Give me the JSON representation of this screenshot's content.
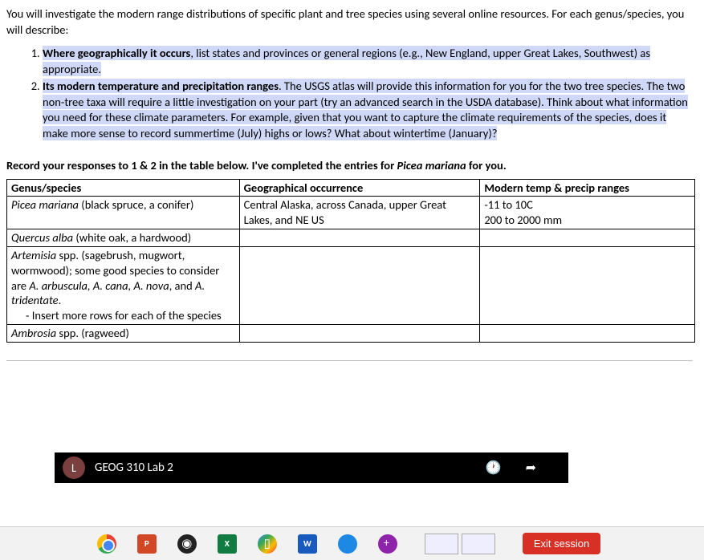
{
  "intro": "You will investigate the modern range distributions of specific plant and tree species using several online resources. For each genus/species, you will describe:",
  "list": {
    "item1_bold": "Where geographically it occurs",
    "item1_rest": ", list states and provinces or general regions (e.g., New England, upper Great Lakes, Southwest) as appropriate.",
    "item2_bold": "Its modern temperature and precipitation ranges",
    "item2_rest": ". The USGS atlas will provide this information for you for the two tree species. The two non-tree taxa will require a little investigation on your part (try an advanced search in the USDA database). Think about what information you need for these climate parameters. For example, given that you want to capture the climate requirements of the species, does it make more sense to record summertime (July) highs or lows? What about wintertime (January)?"
  },
  "record_prefix": "Record your responses to 1 & 2 in the table below. I've completed the entries for ",
  "record_species": "Picea mariana",
  "record_suffix": " for you.",
  "table": {
    "h1": "Genus/species",
    "h2": "Geographical occurrence",
    "h3": "Modern temp & precip ranges",
    "r1": {
      "species_ital": "Picea mariana",
      "species_rest": " (black spruce, a conifer)",
      "geo": "Central Alaska, across Canada, upper Great Lakes, and NE US",
      "temp_line1": "-11 to 10C",
      "temp_line2": "200 to 2000 mm"
    },
    "r2": {
      "species_ital": "Quercus alba",
      "species_rest": " (white oak, a hardwood)"
    },
    "r3": {
      "species_ital": "Artemisia",
      "species_mid": " spp. (sagebrush, mugwort, wormwood); some good species to consider are ",
      "species_list": "A. arbuscula, A. cana, A. nova",
      "species_end": ", and ",
      "species_last": "A. tridentate",
      "species_dot": ".",
      "sub_bullet": "-   Insert more rows for each of the species"
    },
    "r4": {
      "species_ital": "Ambrosia",
      "species_rest": " spp. (ragweed)"
    }
  },
  "video": {
    "avatar": "L",
    "title": "GEOG 310 Lab 2",
    "clock": "🕐",
    "share": "➦"
  },
  "taskbar": {
    "ppt": "P",
    "obs": "◉",
    "excel": "X",
    "meet": "▯",
    "word": "W",
    "exit": "Exit session"
  }
}
